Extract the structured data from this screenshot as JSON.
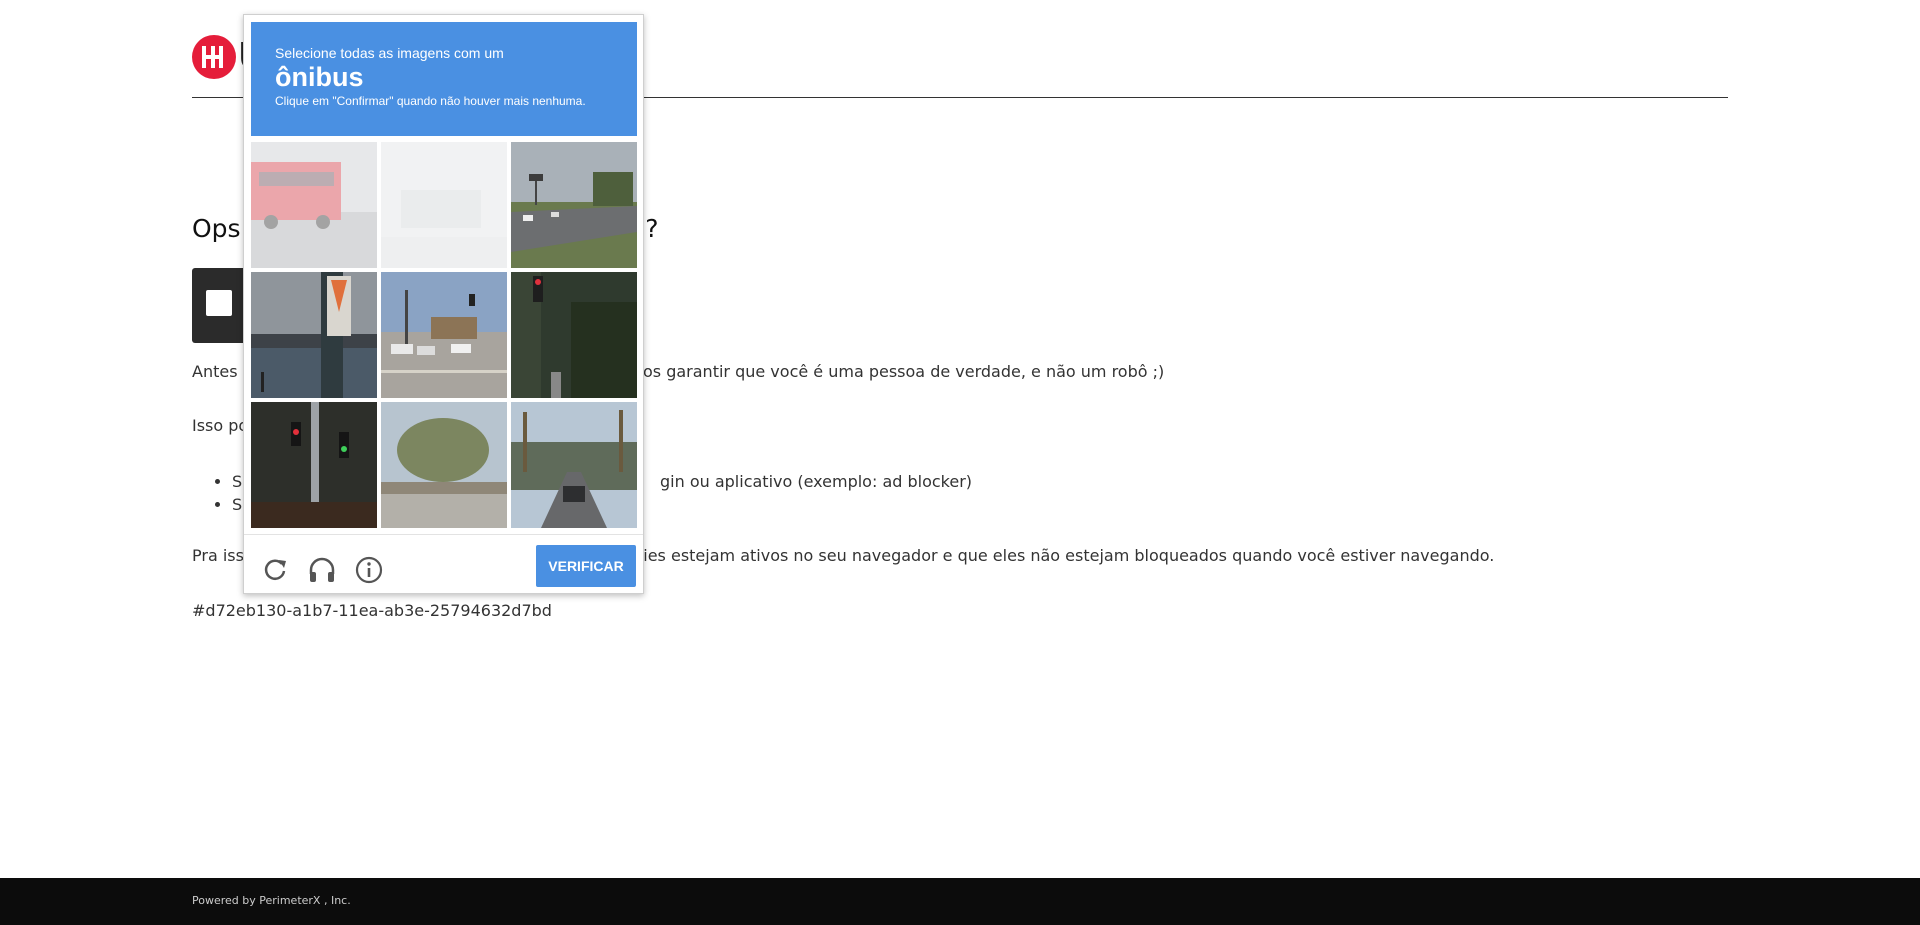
{
  "header": {
    "logo_letter": "U"
  },
  "page": {
    "title_start": "Ops!",
    "title_end": "ô?",
    "para1_tail": "os garantir que você é uma pessoa de verdade, e não um robô ;)",
    "para1_head": "Antes c",
    "para2_head": "Isso po",
    "bullets": [
      {
        "head": "Se",
        "tail": "gin ou aplicativo (exemplo: ad blocker)"
      },
      {
        "head": "Se",
        "tail": ""
      }
    ],
    "para3_head": "Pra isso",
    "para3_tail": "kies estejam ativos no seu navegador e que eles não estejam bloqueados quando você estiver navegando.",
    "reference_id": "#d72eb130-a1b7-11ea-ab3e-25794632d7bd"
  },
  "captcha": {
    "instruction": "Selecione todas as imagens com um",
    "keyword": "ônibus",
    "subtext": "Clique em \"Confirmar\" quando não houver mais nenhuma.",
    "verify_label": "VERIFICAR",
    "icons": {
      "reload": "reload-icon",
      "audio": "headphones-icon",
      "info": "info-icon"
    },
    "tiles": [
      {
        "scene": "red bus on road",
        "faded": true
      },
      {
        "scene": "faded bus",
        "faded": true
      },
      {
        "scene": "highway with cars and trees",
        "faded": false
      },
      {
        "scene": "waterfront pier with sign",
        "faded": false
      },
      {
        "scene": "intersection with cars",
        "faded": false
      },
      {
        "scene": "traffic light near hedge",
        "faded": false
      },
      {
        "scene": "traffic light at night",
        "faded": false
      },
      {
        "scene": "palm trees by road",
        "faded": false
      },
      {
        "scene": "street with palm trees and cars",
        "faded": false
      }
    ],
    "colors": {
      "header": "#4a90e2",
      "button": "#4a90e2"
    }
  },
  "footer": {
    "text": "Powered by PerimeterX , Inc."
  },
  "colors": {
    "logo": "#e51d3a",
    "footer_bg": "#0c0c0c"
  }
}
